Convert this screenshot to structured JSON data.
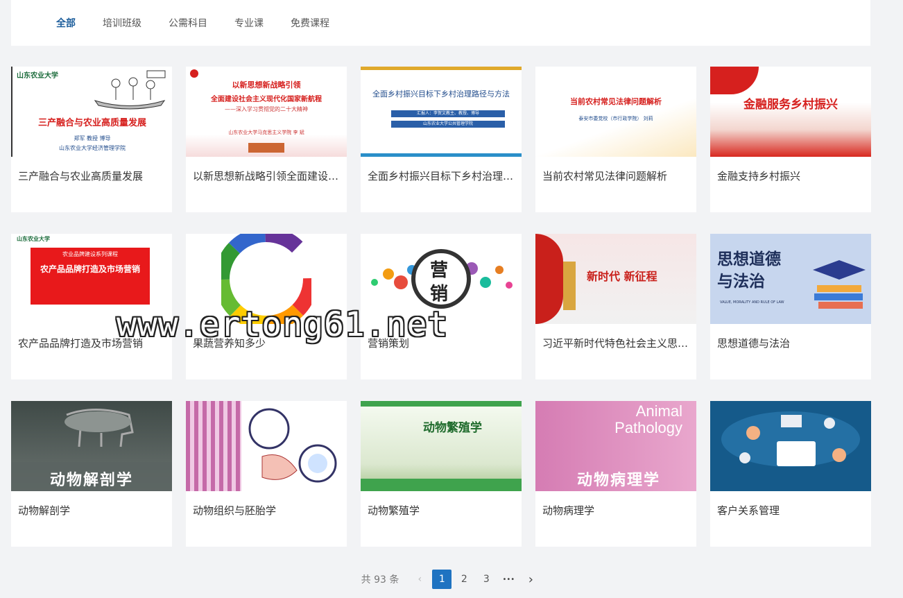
{
  "tabs": [
    {
      "label": "全部",
      "active": true
    },
    {
      "label": "培训班级"
    },
    {
      "label": "公需科目"
    },
    {
      "label": "专业课"
    },
    {
      "label": "免费课程"
    }
  ],
  "courses": [
    {
      "title": "三产融合与农业高质量发展",
      "thumb": {
        "logo": "山东农业大学",
        "headline": "三产融合与农业高质量发展",
        "byline": "郑军 教授 博导",
        "org": "山东农业大学经济管理学院"
      }
    },
    {
      "title": "以新思想新战略引领全面建设社会主义现代化国家新航程",
      "thumb": {
        "line1": "以新思想新战略引领",
        "line2": "全面建设社会主义现代化国家新航程",
        "line3": "——深入学习贯彻党的二十大精神",
        "line4": "山东农业大学马克思主义学院 李 斌"
      }
    },
    {
      "title": "全面乡村振兴目标下乡村治理路径与方法",
      "thumb": {
        "headline": "全面乡村振兴目标下乡村治理路径与方法",
        "bar1": "汇报人：李贺文教主、教授、博导",
        "bar2": "山东农业大学公共管理学院"
      }
    },
    {
      "title": "当前农村常见法律问题解析",
      "thumb": {
        "headline": "当前农村常见法律问题解析",
        "byline": "泰安市委党校（市行政学院） 刘莉"
      }
    },
    {
      "title": "金融支持乡村振兴",
      "thumb": {
        "headline": "金融服务乡村振兴"
      }
    },
    {
      "title": "农产品品牌打造及市场营销",
      "thumb": {
        "logo": "山东农业大学",
        "series": "农业品牌建设系列课程",
        "headline": "农产品品牌打造及市场营销"
      }
    },
    {
      "title": "果蔬营养知多少",
      "thumb": {}
    },
    {
      "title": "营销策划",
      "thumb": {
        "char1": "营",
        "char2": "销"
      }
    },
    {
      "title": "习近平新时代特色社会主义思想概论",
      "thumb": {
        "headline": "新时代 新征程"
      }
    },
    {
      "title": "思想道德与法治",
      "thumb": {
        "line1": "思想道德",
        "line2": "与法治",
        "sub": "VALUE, MORALITY AND RULE OF LAW"
      }
    },
    {
      "title": "动物解剖学",
      "thumb": {
        "headline": "动物解剖学"
      }
    },
    {
      "title": "动物组织与胚胎学",
      "thumb": {}
    },
    {
      "title": "动物繁殖学",
      "thumb": {
        "headline": "动物繁殖学"
      }
    },
    {
      "title": "动物病理学",
      "thumb": {
        "en1": "Animal",
        "en2": "Pathology",
        "headline": "动物病理学"
      }
    },
    {
      "title": "客户关系管理",
      "thumb": {}
    }
  ],
  "watermark": "www.ertong61.net",
  "pagination": {
    "total_text": "共 93 条",
    "prev": "‹",
    "pages": [
      "1",
      "2",
      "3"
    ],
    "current": "1",
    "ellipsis": "•••",
    "next": "›"
  },
  "colors": {
    "accent": "#1f73c1",
    "tab_active": "#1d5e9c",
    "party_red": "#d6201e"
  }
}
